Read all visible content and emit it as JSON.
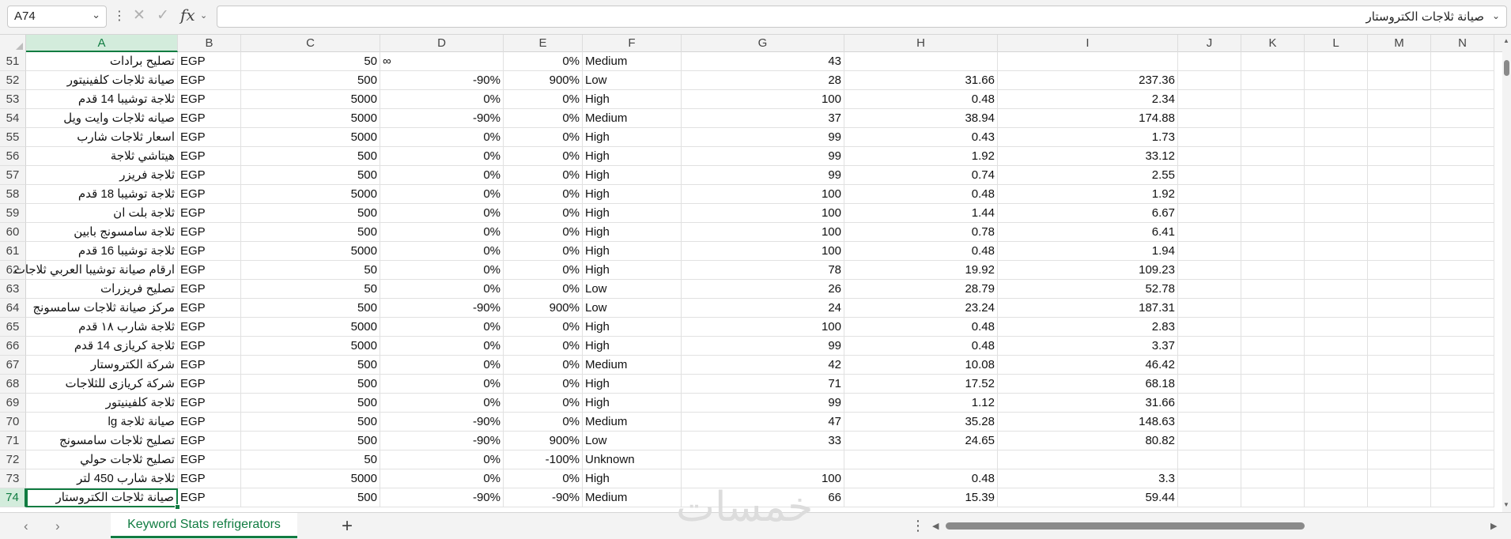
{
  "formula_bar": {
    "name_box": "A74",
    "formula_value": "صيانة ثلاجات الكتروستار",
    "icons": {
      "more": "vertical-dots-icon",
      "cancel": "x-icon",
      "enter": "check-icon",
      "function": "fx-icon"
    }
  },
  "columns": [
    "A",
    "B",
    "C",
    "D",
    "E",
    "F",
    "G",
    "H",
    "I",
    "J",
    "K",
    "L",
    "M",
    "N"
  ],
  "selected_column": "A",
  "rows": [
    {
      "n": "51",
      "a": "تصليح برادات",
      "b": "EGP",
      "c": "50",
      "d": "∞",
      "e": "0%",
      "f": "Medium",
      "g": "43",
      "h": "",
      "i": ""
    },
    {
      "n": "52",
      "a": "صيانة ثلاجات كلفينيتور",
      "b": "EGP",
      "c": "500",
      "d": "-90%",
      "e": "900%",
      "f": "Low",
      "g": "28",
      "h": "31.66",
      "i": "237.36"
    },
    {
      "n": "53",
      "a": "ثلاجة توشيبا 14 قدم",
      "b": "EGP",
      "c": "5000",
      "d": "0%",
      "e": "0%",
      "f": "High",
      "g": "100",
      "h": "0.48",
      "i": "2.34"
    },
    {
      "n": "54",
      "a": "صيانه ثلاجات وايت ويل",
      "b": "EGP",
      "c": "5000",
      "d": "-90%",
      "e": "0%",
      "f": "Medium",
      "g": "37",
      "h": "38.94",
      "i": "174.88"
    },
    {
      "n": "55",
      "a": "اسعار ثلاجات شارب",
      "b": "EGP",
      "c": "5000",
      "d": "0%",
      "e": "0%",
      "f": "High",
      "g": "99",
      "h": "0.43",
      "i": "1.73"
    },
    {
      "n": "56",
      "a": "هيتاشي ثلاجة",
      "b": "EGP",
      "c": "500",
      "d": "0%",
      "e": "0%",
      "f": "High",
      "g": "99",
      "h": "1.92",
      "i": "33.12"
    },
    {
      "n": "57",
      "a": "ثلاجة فريزر",
      "b": "EGP",
      "c": "500",
      "d": "0%",
      "e": "0%",
      "f": "High",
      "g": "99",
      "h": "0.74",
      "i": "2.55"
    },
    {
      "n": "58",
      "a": "ثلاجة توشيبا 18 قدم",
      "b": "EGP",
      "c": "5000",
      "d": "0%",
      "e": "0%",
      "f": "High",
      "g": "100",
      "h": "0.48",
      "i": "1.92"
    },
    {
      "n": "59",
      "a": "ثلاجة بلت ان",
      "b": "EGP",
      "c": "500",
      "d": "0%",
      "e": "0%",
      "f": "High",
      "g": "100",
      "h": "1.44",
      "i": "6.67"
    },
    {
      "n": "60",
      "a": "ثلاجة سامسونج بابين",
      "b": "EGP",
      "c": "500",
      "d": "0%",
      "e": "0%",
      "f": "High",
      "g": "100",
      "h": "0.78",
      "i": "6.41"
    },
    {
      "n": "61",
      "a": "ثلاجة توشيبا 16 قدم",
      "b": "EGP",
      "c": "5000",
      "d": "0%",
      "e": "0%",
      "f": "High",
      "g": "100",
      "h": "0.48",
      "i": "1.94"
    },
    {
      "n": "62",
      "a": "ارقام صيانة توشيبا العربي ثلاجات",
      "b": "EGP",
      "c": "50",
      "d": "0%",
      "e": "0%",
      "f": "High",
      "g": "78",
      "h": "19.92",
      "i": "109.23"
    },
    {
      "n": "63",
      "a": "تصليح فريزرات",
      "b": "EGP",
      "c": "50",
      "d": "0%",
      "e": "0%",
      "f": "Low",
      "g": "26",
      "h": "28.79",
      "i": "52.78"
    },
    {
      "n": "64",
      "a": "مركز صيانة ثلاجات سامسونج",
      "b": "EGP",
      "c": "500",
      "d": "-90%",
      "e": "900%",
      "f": "Low",
      "g": "24",
      "h": "23.24",
      "i": "187.31"
    },
    {
      "n": "65",
      "a": "ثلاجة شارب ١٨ قدم",
      "b": "EGP",
      "c": "5000",
      "d": "0%",
      "e": "0%",
      "f": "High",
      "g": "100",
      "h": "0.48",
      "i": "2.83"
    },
    {
      "n": "66",
      "a": "ثلاجة كريازى 14 قدم",
      "b": "EGP",
      "c": "5000",
      "d": "0%",
      "e": "0%",
      "f": "High",
      "g": "99",
      "h": "0.48",
      "i": "3.37"
    },
    {
      "n": "67",
      "a": "شركة الكتروستار",
      "b": "EGP",
      "c": "500",
      "d": "0%",
      "e": "0%",
      "f": "Medium",
      "g": "42",
      "h": "10.08",
      "i": "46.42"
    },
    {
      "n": "68",
      "a": "شركة كريازى للثلاجات",
      "b": "EGP",
      "c": "500",
      "d": "0%",
      "e": "0%",
      "f": "High",
      "g": "71",
      "h": "17.52",
      "i": "68.18"
    },
    {
      "n": "69",
      "a": "ثلاجة كلفينيتور",
      "b": "EGP",
      "c": "500",
      "d": "0%",
      "e": "0%",
      "f": "High",
      "g": "99",
      "h": "1.12",
      "i": "31.66"
    },
    {
      "n": "70",
      "a": "صيانة ثلاجة lg",
      "b": "EGP",
      "c": "500",
      "d": "-90%",
      "e": "0%",
      "f": "Medium",
      "g": "47",
      "h": "35.28",
      "i": "148.63"
    },
    {
      "n": "71",
      "a": "تصليح ثلاجات سامسونج",
      "b": "EGP",
      "c": "500",
      "d": "-90%",
      "e": "900%",
      "f": "Low",
      "g": "33",
      "h": "24.65",
      "i": "80.82"
    },
    {
      "n": "72",
      "a": "تصليح ثلاجات حولي",
      "b": "EGP",
      "c": "50",
      "d": "0%",
      "e": "-100%",
      "f": "Unknown",
      "g": "",
      "h": "",
      "i": ""
    },
    {
      "n": "73",
      "a": "ثلاجة شارب 450 لتر",
      "b": "EGP",
      "c": "5000",
      "d": "0%",
      "e": "0%",
      "f": "High",
      "g": "100",
      "h": "0.48",
      "i": "3.3"
    },
    {
      "n": "74",
      "a": "صيانة ثلاجات الكتروستار",
      "b": "EGP",
      "c": "500",
      "d": "-90%",
      "e": "-90%",
      "f": "Medium",
      "g": "66",
      "h": "15.39",
      "i": "59.44"
    }
  ],
  "active_row": "74",
  "sheet_tabs": [
    {
      "label": "Keyword Stats refrigerators",
      "active": true
    }
  ],
  "watermark": "خمسات",
  "colors": {
    "accent": "#107c41",
    "header_bg": "#f3f3f3",
    "selected_header_bg": "#d3ecdc"
  }
}
